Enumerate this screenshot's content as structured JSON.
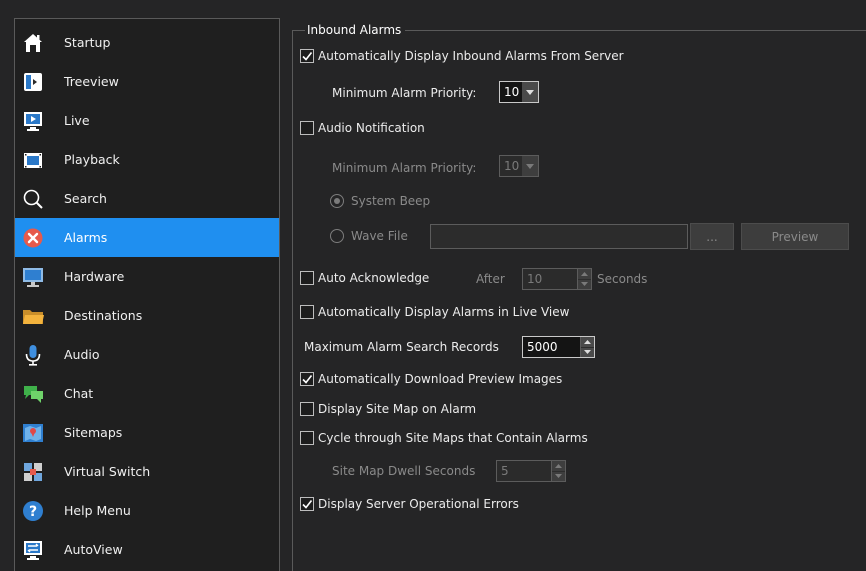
{
  "sidebar": {
    "items": [
      {
        "label": "Startup",
        "icon": "house-icon"
      },
      {
        "label": "Treeview",
        "icon": "treeview-icon"
      },
      {
        "label": "Live",
        "icon": "live-monitor-icon"
      },
      {
        "label": "Playback",
        "icon": "playback-film-icon"
      },
      {
        "label": "Search",
        "icon": "search-icon"
      },
      {
        "label": "Alarms",
        "icon": "alarm-icon",
        "selected": true
      },
      {
        "label": "Hardware",
        "icon": "hardware-monitor-icon"
      },
      {
        "label": "Destinations",
        "icon": "folder-icon"
      },
      {
        "label": "Audio",
        "icon": "microphone-icon"
      },
      {
        "label": "Chat",
        "icon": "chat-bubble-icon"
      },
      {
        "label": "Sitemaps",
        "icon": "sitemap-icon"
      },
      {
        "label": "Virtual Switch",
        "icon": "virtual-switch-icon"
      },
      {
        "label": "Help Menu",
        "icon": "help-icon"
      },
      {
        "label": "AutoView",
        "icon": "autoview-icon"
      }
    ],
    "selected_color": "#1f8ff0"
  },
  "inbound": {
    "title": "Inbound Alarms",
    "auto_display": {
      "label": "Automatically Display Inbound Alarms From Server",
      "checked": true
    },
    "min_priority": {
      "label": "Minimum Alarm Priority:",
      "value": "10"
    },
    "audio_notification": {
      "label": "Audio Notification",
      "checked": false
    },
    "audio_min_priority": {
      "label": "Minimum Alarm Priority:",
      "value": "10"
    },
    "system_beep": {
      "label": "System Beep",
      "selected": true
    },
    "wave_file": {
      "label": "Wave File",
      "value": "",
      "browse_label": "...",
      "preview_label": "Preview"
    },
    "auto_ack": {
      "label": "Auto Acknowledge",
      "checked": false,
      "after_label": "After",
      "value": "10",
      "unit_label": "Seconds"
    },
    "display_live": {
      "label": "Automatically Display Alarms in Live View",
      "checked": false
    },
    "max_search": {
      "label": "Maximum Alarm Search Records",
      "value": "5000"
    },
    "download_preview": {
      "label": "Automatically Download Preview Images",
      "checked": true
    },
    "site_map": {
      "label": "Display Site Map on Alarm",
      "checked": false
    },
    "cycle_site_maps": {
      "label": "Cycle through Site Maps that Contain Alarms",
      "checked": false
    },
    "dwell": {
      "label": "Site Map Dwell Seconds",
      "value": "5"
    },
    "operational_errors": {
      "label": "Display Server Operational Errors",
      "checked": true
    }
  }
}
